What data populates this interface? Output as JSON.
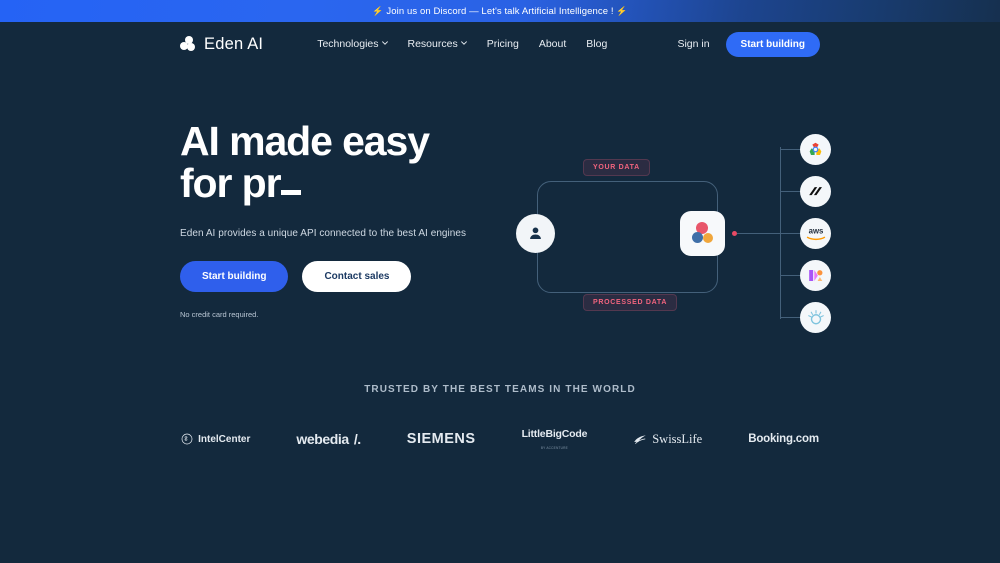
{
  "colors": {
    "background": "#13293d",
    "banner_blue": "#2563f5",
    "accent_blue": "#2f6bf6",
    "label_pink": "#f2647e",
    "wire": "#44607a"
  },
  "banner": {
    "bolt_left": "⚡",
    "text": "Join us on Discord — Let's talk Artificial Intelligence !",
    "bolt_right": "⚡"
  },
  "nav": {
    "logo_text": "Eden AI",
    "links": [
      {
        "label": "Technologies",
        "has_caret": true
      },
      {
        "label": "Resources",
        "has_caret": true
      },
      {
        "label": "Pricing",
        "has_caret": false
      },
      {
        "label": "About",
        "has_caret": false
      },
      {
        "label": "Blog",
        "has_caret": false
      }
    ],
    "signin_label": "Sign in",
    "cta_label": "Start building"
  },
  "hero": {
    "title": "AI made easy for pr",
    "subtitle": "Eden AI provides a unique API connected to the best AI engines",
    "primary_button": "Start building",
    "secondary_button": "Contact sales",
    "note": "No credit card required."
  },
  "diagram": {
    "label_top": "YOUR DATA",
    "label_bottom": "PROCESSED DATA",
    "user_node": "user-avatar-icon",
    "center_node": "eden-ai-logo-icon",
    "providers": [
      {
        "name": "google-cloud-icon"
      },
      {
        "name": "dark-slash-provider-icon"
      },
      {
        "name": "aws-icon",
        "label": "aws"
      },
      {
        "name": "purple-orange-provider-icon"
      },
      {
        "name": "light-blue-orb-provider-icon"
      }
    ]
  },
  "trusted": {
    "title": "TRUSTED BY THE BEST TEAMS IN THE WORLD",
    "logos": [
      {
        "name": "intelcenter-logo",
        "text": "IntelCenter",
        "sub": ""
      },
      {
        "name": "webedia-logo",
        "text": "webedia",
        "sub": ""
      },
      {
        "name": "siemens-logo",
        "text": "SIEMENS",
        "sub": ""
      },
      {
        "name": "littlebigcode-logo",
        "text": "LittleBigCode",
        "sub": "BY ACCENTURE"
      },
      {
        "name": "swisslife-logo",
        "text": "SwissLife",
        "sub": ""
      },
      {
        "name": "booking-logo",
        "text": "Booking.com",
        "sub": ""
      }
    ]
  }
}
